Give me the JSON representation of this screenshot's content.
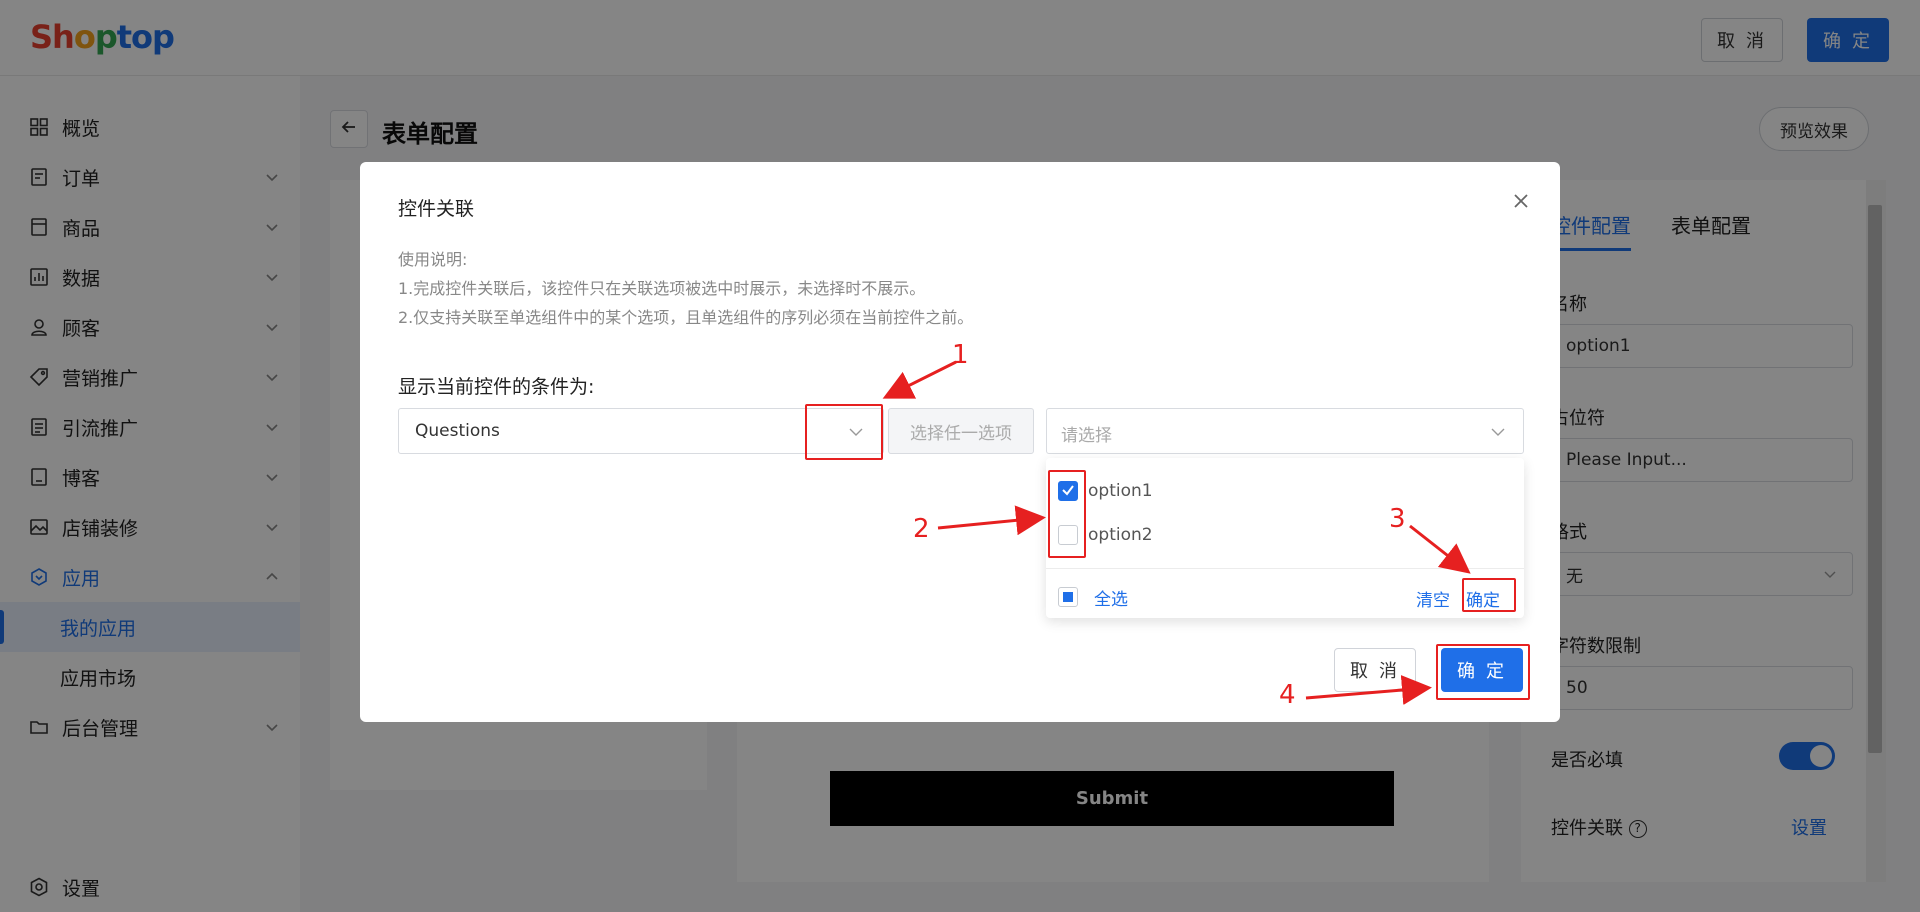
{
  "header": {
    "logo_letters": [
      "S",
      "h",
      "o",
      "p",
      "t",
      "o",
      "p"
    ],
    "logo_colors": [
      "#e8402f",
      "#e8402f",
      "#f4a21b",
      "#34a853",
      "#1f6fe8",
      "#1f6fe8",
      "#1f6fe8"
    ],
    "cancel_label": "取 消",
    "ok_label": "确 定"
  },
  "sidebar": {
    "items": [
      {
        "label": "概览",
        "icon": "dashboard-icon"
      },
      {
        "label": "订单",
        "icon": "order-icon"
      },
      {
        "label": "商品",
        "icon": "product-icon"
      },
      {
        "label": "数据",
        "icon": "chart-icon"
      },
      {
        "label": "顾客",
        "icon": "user-icon"
      },
      {
        "label": "营销推广",
        "icon": "tag-icon"
      },
      {
        "label": "引流推广",
        "icon": "list-icon"
      },
      {
        "label": "博客",
        "icon": "blog-icon"
      },
      {
        "label": "店铺装修",
        "icon": "image-icon"
      },
      {
        "label": "应用",
        "icon": "app-icon"
      },
      {
        "label": "后台管理",
        "icon": "folder-icon"
      }
    ],
    "sub_items": [
      "我的应用",
      "应用市场"
    ],
    "settings_label": "设置"
  },
  "page": {
    "title": "表单配置",
    "preview_label": "预览效果",
    "submit_label": "Submit"
  },
  "right_panel": {
    "tabs": [
      "控件配置",
      "表单配置"
    ],
    "name_label": "名称",
    "name_value": "option1",
    "placeholder_label": "占位符",
    "placeholder_value": "Please Input...",
    "format_label": "格式",
    "format_value": "无",
    "charlimit_label": "字符数限制",
    "charlimit_value": "50",
    "required_label": "是否必填",
    "required_on": true,
    "link_label": "控件关联",
    "link_action": "设置"
  },
  "modal": {
    "title": "控件关联",
    "usage_title": "使用说明:",
    "usage_line1": "1.完成控件关联后，该控件只在关联选项被选中时展示，未选择时不展示。",
    "usage_line2": "2.仅支持关联至单选组件中的某个选项，且单选组件的序列必须在当前控件之前。",
    "condition_label": "显示当前控件的条件为:",
    "select1_value": "Questions",
    "any_option_label": "选择任一选项",
    "select2_placeholder": "请选择",
    "options": [
      {
        "label": "option1",
        "checked": true
      },
      {
        "label": "option2",
        "checked": false
      }
    ],
    "select_all_label": "全选",
    "clear_label": "清空",
    "dropdown_ok_label": "确定",
    "cancel_label": "取 消",
    "ok_label": "确 定"
  },
  "annotations": {
    "numbers": [
      "1",
      "2",
      "3",
      "4"
    ],
    "color": "#e62020"
  },
  "colors": {
    "accent": "#1f6fe8"
  }
}
